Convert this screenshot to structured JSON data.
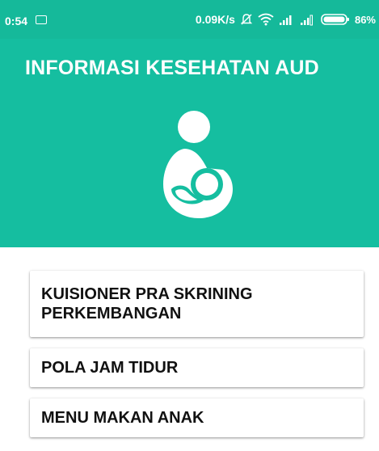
{
  "status_bar": {
    "time": "0:54",
    "notification_icon": "notification-icon",
    "network_speed": "0.09K/s",
    "icons": [
      "mute-icon",
      "wifi-icon",
      "signal-icon",
      "signal-icon",
      "battery-icon"
    ],
    "battery_percent": "86%"
  },
  "header": {
    "title": "INFORMASI KESEHATAN AUD",
    "icon": "breastfeeding-mother-icon",
    "background_color": "#15bea0"
  },
  "menu": {
    "items": [
      {
        "label": "KUISIONER PRA SKRINING PERKEMBANGAN"
      },
      {
        "label": "POLA JAM TIDUR"
      },
      {
        "label": "MENU MAKAN ANAK"
      }
    ]
  },
  "colors": {
    "accent": "#15bea0",
    "status_bar": "#15b99a",
    "card_background": "#ffffff",
    "card_text": "#111111"
  }
}
